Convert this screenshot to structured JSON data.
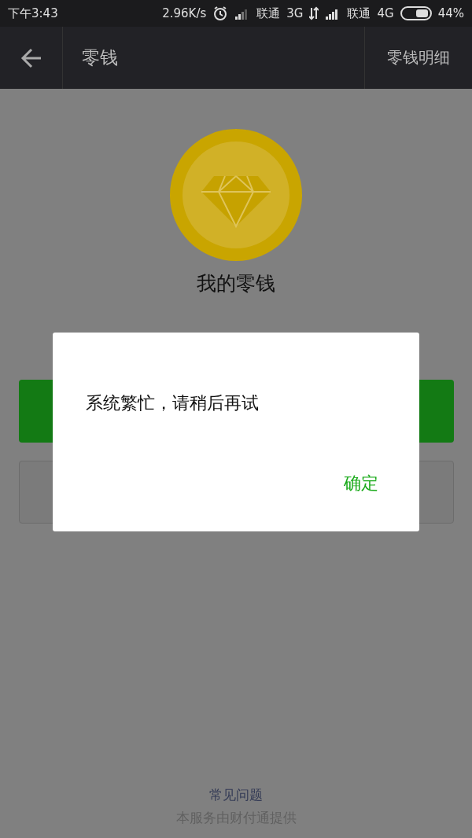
{
  "status_bar": {
    "time": "下午3:43",
    "speed": "2.96K/s",
    "carrier_1": "联通",
    "network_1": "3G",
    "carrier_2": "联通",
    "network_2": "4G",
    "battery": "44%"
  },
  "nav": {
    "title": "零钱",
    "action": "零钱明细"
  },
  "balance": {
    "label": "我的零钱"
  },
  "dialog": {
    "message": "系统繁忙，请稍后再试",
    "confirm": "确定"
  },
  "footer": {
    "faq": "常见问题",
    "provider": "本服务由财付通提供"
  }
}
